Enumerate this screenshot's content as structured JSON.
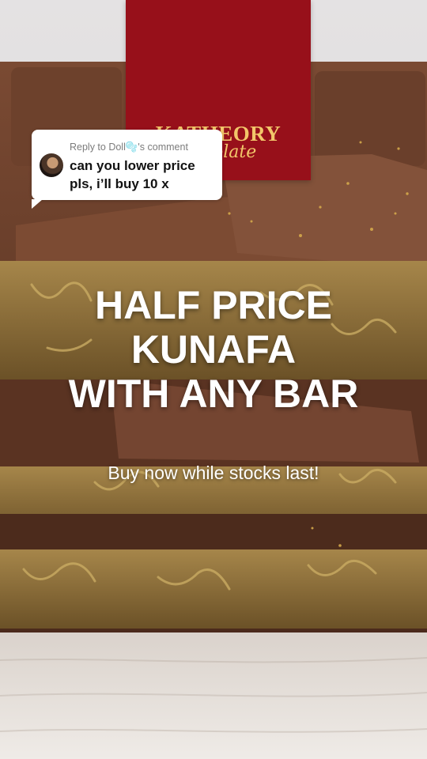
{
  "brand": {
    "name": "KATHEORY",
    "subname": "olate",
    "banner_color": "#97101a",
    "logo_color": "#f2c66a"
  },
  "reply": {
    "label": "Reply to Doll🫧's comment",
    "text": "can you lower price pls, i’ll buy 10 x"
  },
  "promo": {
    "headline": "HALF PRICE\nKUNAFA\nWITH ANY BAR",
    "subline": "Buy now while stocks last!"
  },
  "colors": {
    "chocolate": "#5e3623",
    "kunafa": "#9b7b3e",
    "table": "#e8e2dc"
  }
}
